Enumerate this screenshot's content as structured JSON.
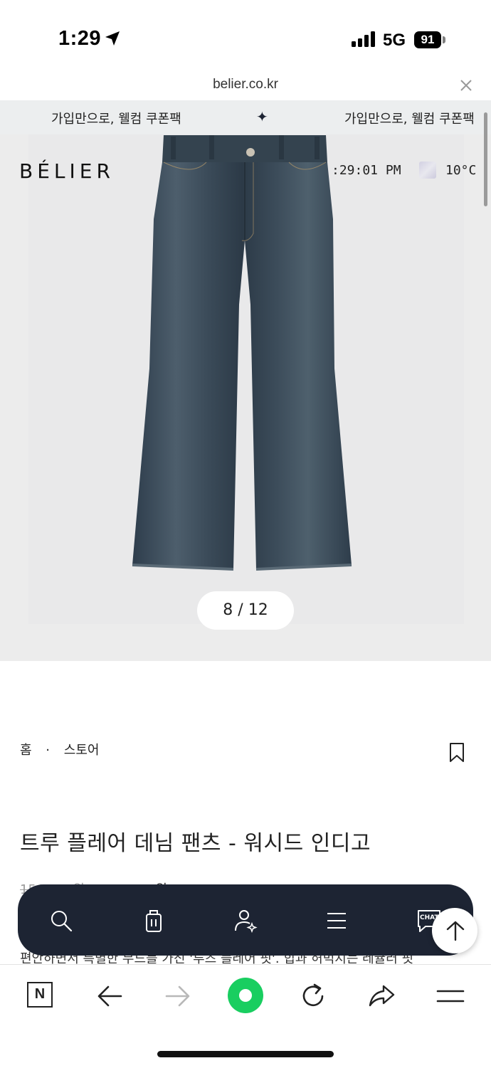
{
  "status_bar": {
    "time": "1:29",
    "network": "5G",
    "battery": "91"
  },
  "browser": {
    "url": "belier.co.kr",
    "close_icon": "close-icon"
  },
  "announcement": {
    "left_text": "가입만으로, 웰컴 쿠폰팩",
    "separator": "✦",
    "right_text": "가입만으로, 웰컴 쿠폰팩"
  },
  "header": {
    "logo": "BÉLIER",
    "clock": ":29:01 PM",
    "temperature": "10°C"
  },
  "gallery": {
    "current": "8",
    "total": "12",
    "counter_text": "8 / 12"
  },
  "product": {
    "breadcrumb_home": "홈",
    "breadcrumb_sep": "·",
    "breadcrumb_store": "스토어",
    "title": "트루 플레어 데님 팬츠 - 워시드 인디고",
    "price_original": "156,000원",
    "price_sale": "140,000원",
    "description": "편안하면서 특별한 무드를 가진 '루즈 플레어 핏'. 힙과 허벅지는 레귤러 핏"
  },
  "floating_nav": {
    "items": [
      "search-icon",
      "shopping-bag-icon",
      "account-icon",
      "menu-icon",
      "chat-icon"
    ],
    "chat_label": "CHAT"
  },
  "toolbar": {
    "items": [
      "naver-home",
      "back",
      "forward",
      "green-dot",
      "reload",
      "share",
      "menu"
    ],
    "naver_label": "N"
  },
  "colors": {
    "nav_bg": "#1d2433",
    "accent_green": "#19ce60",
    "announce_bg": "#eceeef"
  }
}
